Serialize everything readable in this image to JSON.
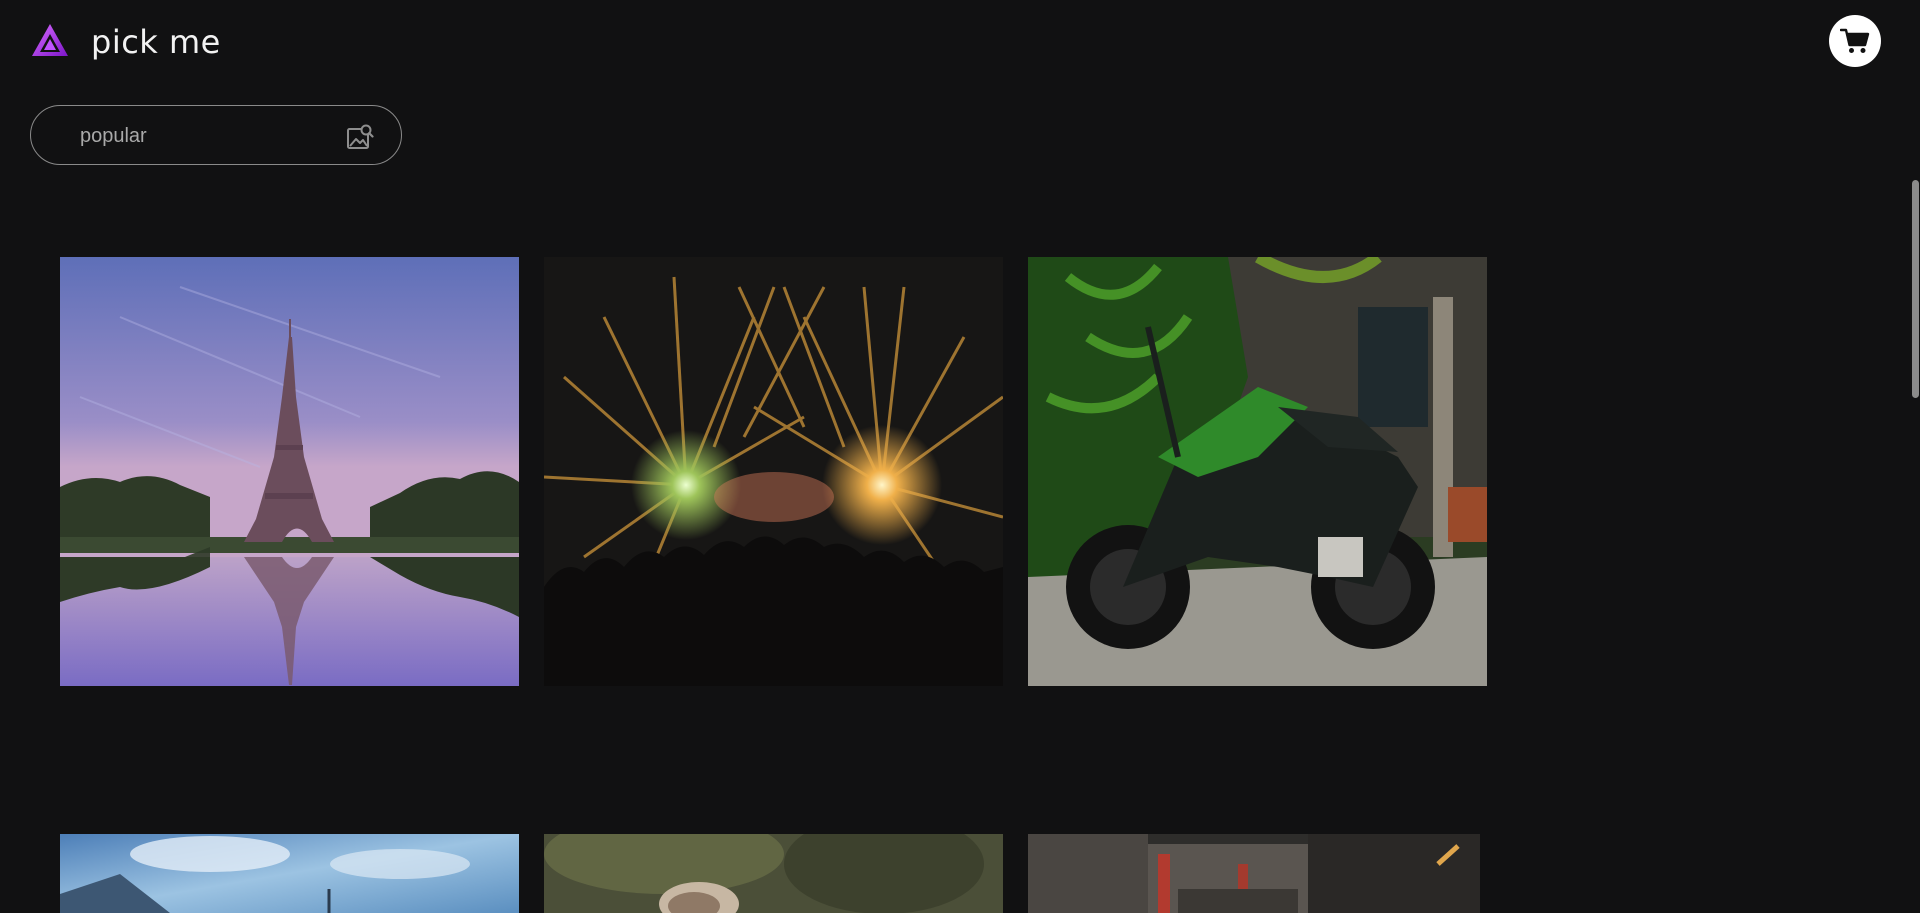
{
  "app": {
    "brand": "pick me",
    "accent_color": "#a43be0",
    "background_color": "#111112"
  },
  "header": {
    "logo_icon": "triangle-logo-icon",
    "cart_icon": "shopping-cart-icon"
  },
  "search": {
    "value": "",
    "placeholder": "popular",
    "icon": "image-search-icon"
  },
  "gallery": {
    "images": [
      {
        "subject": "eiffel-tower"
      },
      {
        "subject": "concert-lights"
      },
      {
        "subject": "green-motorcycle"
      },
      {
        "subject": "mountain-sky"
      },
      {
        "subject": "animal-blurred"
      },
      {
        "subject": "city-street"
      }
    ]
  }
}
